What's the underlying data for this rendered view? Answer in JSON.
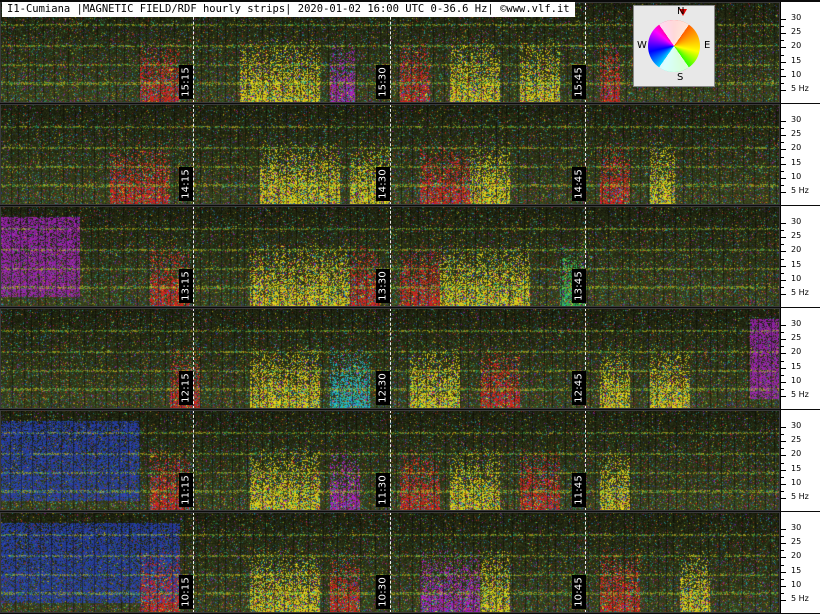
{
  "title": "I1-Cumiana |MAGNETIC FIELD/RDF hourly strips| 2020-01-02 16:00 UTC 0-36.6 Hz| ©www.vlf.it",
  "compass": {
    "north": "N",
    "south": "S",
    "east": "E",
    "west": "W"
  },
  "colors": {
    "background": "#0b0b0b",
    "axis_background": "#ffffff",
    "divider": "#ffffff",
    "signal_yellow": "#f2e21b",
    "signal_red": "#e3211c",
    "signal_green": "#2ec45a",
    "signal_magenta": "#b21fd0",
    "signal_cyan": "#1ec8d8",
    "signal_blue": "#2440c8"
  },
  "strips": [
    {
      "time_labels": [
        "15:15",
        "15:30",
        "15:45"
      ]
    },
    {
      "time_labels": [
        "14:15",
        "14:30",
        "14:45"
      ]
    },
    {
      "time_labels": [
        "13:15",
        "13:30",
        "13:45"
      ]
    },
    {
      "time_labels": [
        "12:15",
        "12:30",
        "12:45"
      ]
    },
    {
      "time_labels": [
        "11:15",
        "11:30",
        "11:45"
      ]
    },
    {
      "time_labels": [
        "10:15",
        "10:30",
        "10:45"
      ]
    }
  ],
  "frequency_axis": {
    "ticks": [
      "30",
      "25",
      "20",
      "15",
      "10",
      "5 Hz"
    ]
  }
}
